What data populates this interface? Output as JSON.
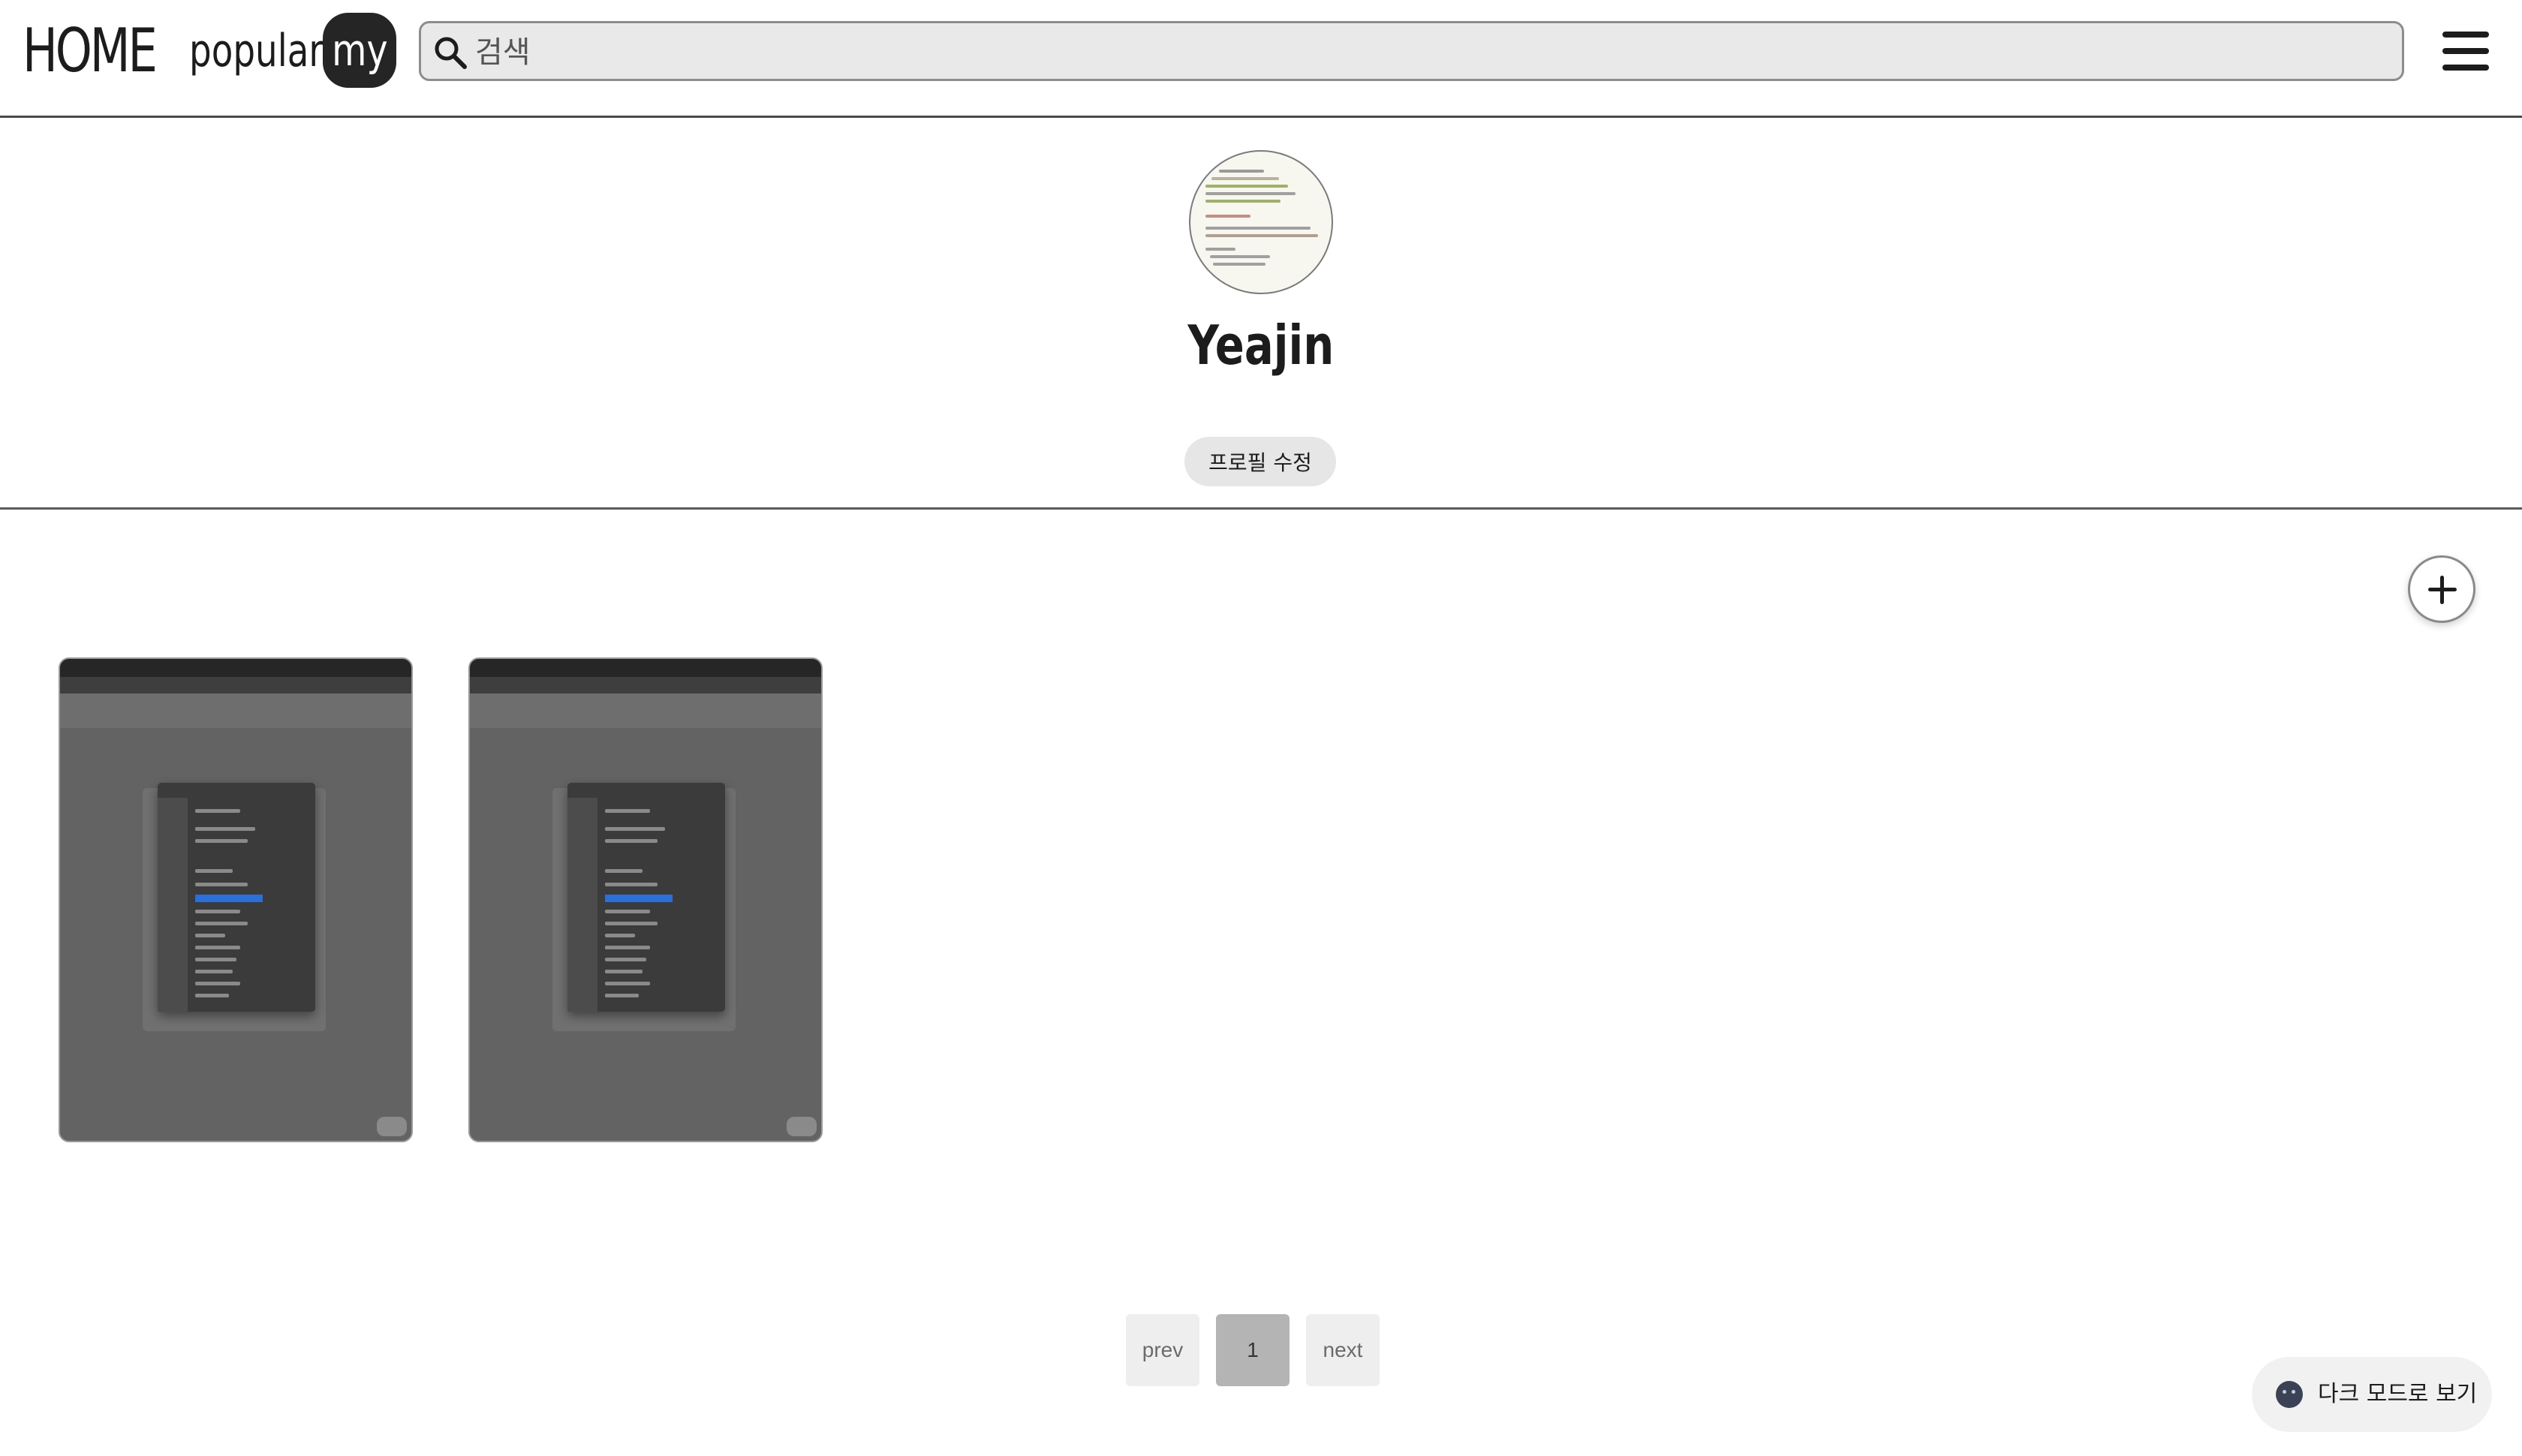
{
  "nav": {
    "home_label": "HOME",
    "popular_label": "popular",
    "my_label": "my",
    "search_placeholder": "검색",
    "menu_icon": "hamburger-menu-icon",
    "search_icon": "search-icon"
  },
  "profile": {
    "username": "Yeajin",
    "edit_button_label": "프로필 수정"
  },
  "posts": {
    "add_icon": "plus-icon",
    "items": [
      {
        "kind": "screenshot-thumbnail"
      },
      {
        "kind": "screenshot-thumbnail"
      }
    ]
  },
  "pagination": {
    "prev_label": "prev",
    "current_page": "1",
    "next_label": "next"
  },
  "theme_toggle": {
    "label": "다크 모드로 보기",
    "icon": "moon-face-icon"
  },
  "colors": {
    "active_nav_bg": "#252525",
    "search_bg": "#e9e9e9",
    "current_page_bg": "#b4b4b4",
    "thumbnail_bg": "#636363"
  }
}
